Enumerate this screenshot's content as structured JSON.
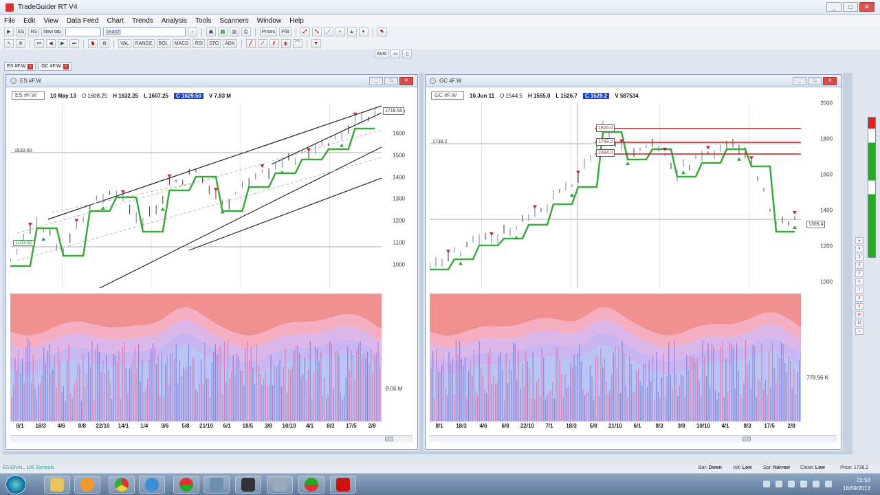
{
  "window": {
    "title": "TradeGuider RT V4"
  },
  "menu": [
    "File",
    "Edit",
    "View",
    "Data Feed",
    "Chart",
    "Trends",
    "Analysis",
    "Tools",
    "Scanners",
    "Window",
    "Help"
  ],
  "toolbar1": {
    "b1": "ES",
    "b2": "RS",
    "newtab": "New tab",
    "search": "Search",
    "prices": "Prices",
    "pb": "P/B"
  },
  "toolbar2": {
    "b1": "VAL",
    "b2": "RANGE",
    "b3": "BOL",
    "b4": "MACD",
    "b5": "RSI",
    "b6": "STO",
    "b7": "ADX"
  },
  "toolbar3": {
    "auto": "Auto"
  },
  "tabs": [
    {
      "label": "ES #F.W"
    },
    {
      "label": "GC #F.W"
    }
  ],
  "charts": [
    {
      "title": "ES #F.W",
      "symbol": "ES #F.W",
      "date": "10 May 13",
      "open": "O 1608.25",
      "high": "H 1632.25",
      "low": "L 1607.25",
      "close": "C 1629.50",
      "vol": "V 7.83 M",
      "y_labels": [
        "1700",
        "1600",
        "1500",
        "1400",
        "1300",
        "1200",
        "1100",
        "1000"
      ],
      "last_price": "1718.50",
      "level_left": "1530.00",
      "level_green": "1103.92",
      "vol_label": "8.06 M",
      "x_labels": [
        "8/1",
        "18/3",
        "4/6",
        "8/8",
        "22/10",
        "14/1",
        "1/4",
        "3/6",
        "5/8",
        "21/10",
        "6/1",
        "18/5",
        "3/8",
        "10/10",
        "4/1",
        "8/3",
        "17/5",
        "2/8"
      ]
    },
    {
      "title": "GC #F.W",
      "symbol": "GC #F.W",
      "date": "10 Jun 11",
      "open": "O 1544.5",
      "high": "H 1555.0",
      "low": "L 1526.7",
      "close": "C 1529.2",
      "vol": "V 587534",
      "y_labels": [
        "2000",
        "1800",
        "1600",
        "1400",
        "1200",
        "1000"
      ],
      "last_price": "1305.4",
      "level_left": "1738.2",
      "boxes": [
        "1820.0",
        "1743.2",
        "1694.0"
      ],
      "vol_label": "778.96 K",
      "x_labels": [
        "8/1",
        "18/3",
        "4/6",
        "6/8",
        "22/10",
        "7/1",
        "18/3",
        "5/8",
        "21/10",
        "6/1",
        "8/3",
        "3/8",
        "10/10",
        "4/1",
        "8/3",
        "17/5",
        "2/8"
      ]
    }
  ],
  "status": {
    "left": "ESIGNAL, 106 Symbols",
    "bar": "Bar: ",
    "bar_v": "Down",
    "vol": "Vol: ",
    "vol_v": "Low",
    "spr": "Spr: ",
    "spr_v": "Narrow",
    "close": "Close: ",
    "close_v": "Low",
    "price": "Price: 1738.2"
  },
  "clock": {
    "time": "21:53",
    "date": "18/09/2013"
  },
  "colors": {
    "accent": "#1b3fd9",
    "up_marker": "#2aa33a",
    "down_marker": "#c0203a",
    "volume_bg": "#f08a8a"
  }
}
